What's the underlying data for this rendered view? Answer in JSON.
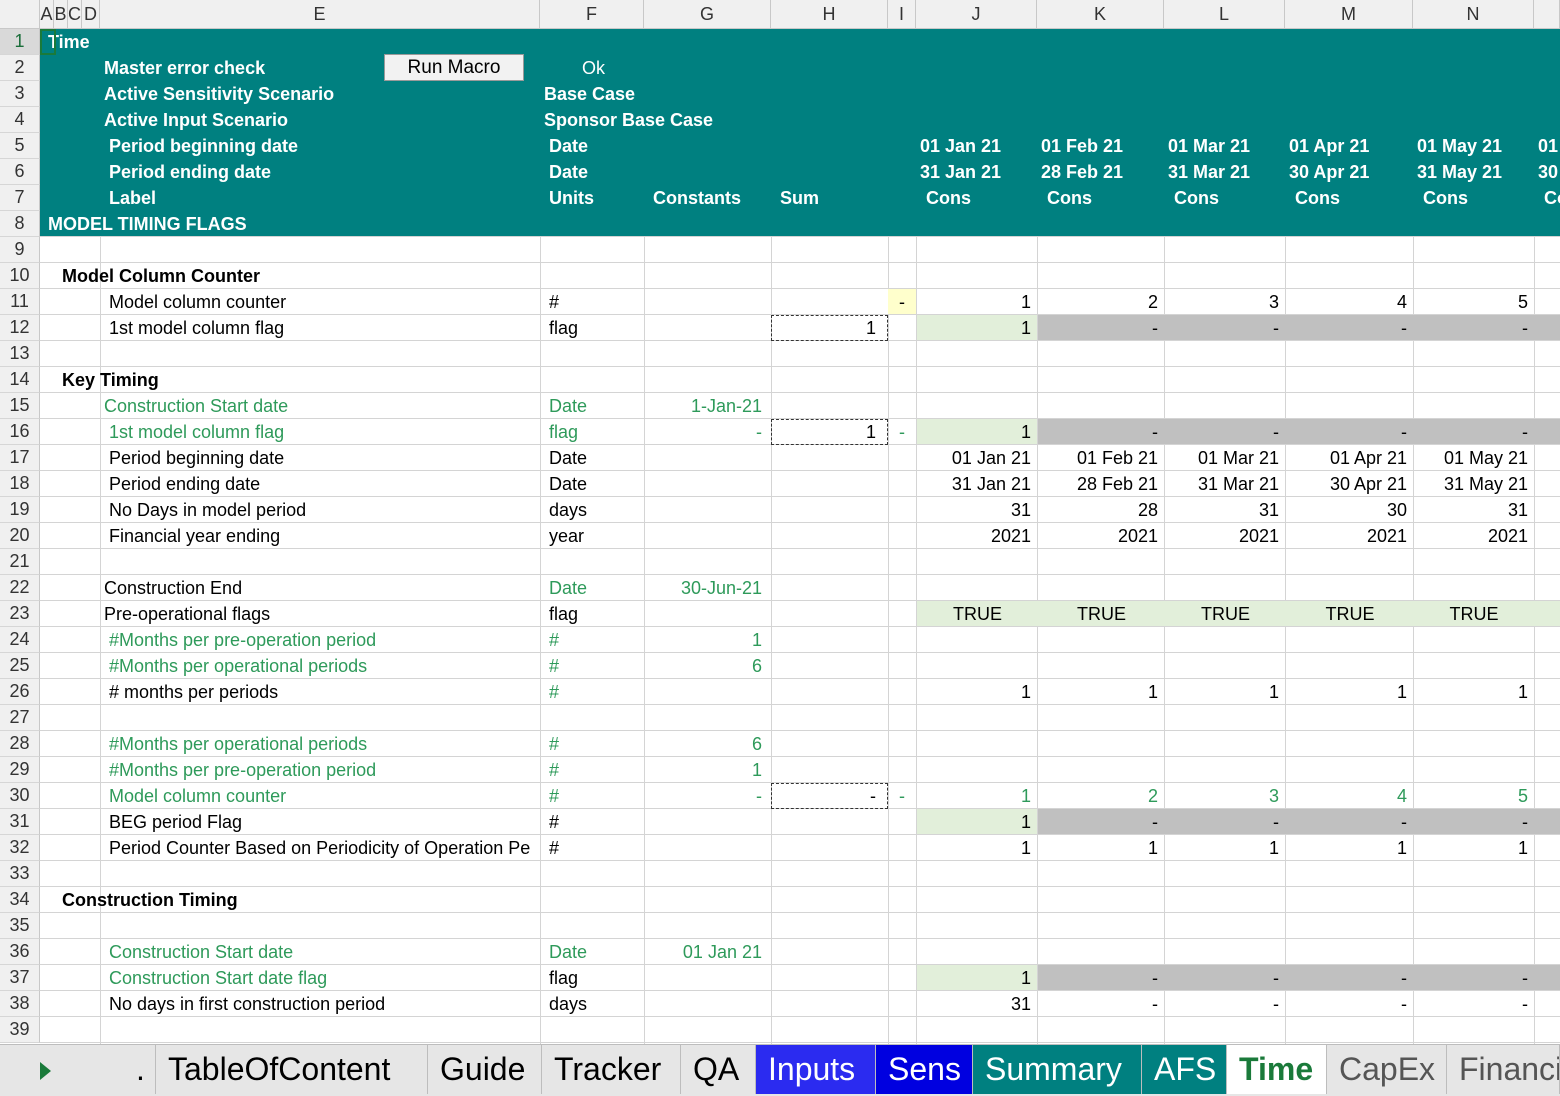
{
  "columns": [
    "A",
    "B",
    "C",
    "D",
    "E",
    "F",
    "G",
    "H",
    "I",
    "J",
    "K",
    "L",
    "M",
    "N"
  ],
  "rows": [
    "1",
    "2",
    "3",
    "4",
    "5",
    "6",
    "7",
    "8",
    "9",
    "10",
    "11",
    "12",
    "13",
    "14",
    "15",
    "16",
    "17",
    "18",
    "19",
    "20",
    "21",
    "22",
    "23",
    "24",
    "25",
    "26",
    "27",
    "28",
    "29",
    "30",
    "31",
    "32",
    "33",
    "34",
    "35",
    "36",
    "37",
    "38",
    "39"
  ],
  "header": {
    "sheet_title": "Time",
    "master_error_label": "Master error check",
    "run_macro_button": "Run Macro",
    "master_error_value": "Ok",
    "sens_label": "Active Sensitivity Scenario",
    "sens_value": "Base Case",
    "input_label": "Active Input Scenario",
    "input_value": "Sponsor Base Case",
    "pbd_label": "Period beginning date",
    "pbd_unit": "Date",
    "ped_label": "Period ending date",
    "ped_unit": "Date",
    "label_label": "Label",
    "units_header": "Units",
    "constants_header": "Constants",
    "sum_header": "Sum",
    "section_title": "MODEL TIMING FLAGS",
    "period_begin": [
      "01 Jan 21",
      "01 Feb 21",
      "01 Mar 21",
      "01 Apr 21",
      "01 May 21",
      "01"
    ],
    "period_end": [
      "31 Jan 21",
      "28 Feb 21",
      "31 Mar 21",
      "30 Apr 21",
      "31 May 21",
      "30"
    ],
    "period_label": [
      "Cons",
      "Cons",
      "Cons",
      "Cons",
      "Cons",
      "Co"
    ]
  },
  "body": {
    "r10": "Model Column Counter",
    "r11": {
      "label": "Model column counter",
      "unit": "#",
      "i": "-",
      "vals": [
        "1",
        "2",
        "3",
        "4",
        "5"
      ]
    },
    "r12": {
      "label": "1st model column flag",
      "unit": "flag",
      "sum": "1",
      "vals": [
        "1",
        "-",
        "-",
        "-",
        "-"
      ]
    },
    "r14": "Key Timing",
    "r15": {
      "label": "Construction Start date",
      "unit": "Date",
      "const": "1-Jan-21"
    },
    "r16": {
      "label": "1st model column flag",
      "unit": "flag",
      "const": "-",
      "sum": "1",
      "i": "-",
      "vals": [
        "1",
        "-",
        "-",
        "-",
        "-"
      ]
    },
    "r17": {
      "label": "Period beginning date",
      "unit": "Date",
      "vals": [
        "01 Jan 21",
        "01 Feb 21",
        "01 Mar 21",
        "01 Apr 21",
        "01 May 21"
      ]
    },
    "r18": {
      "label": "Period ending date",
      "unit": "Date",
      "vals": [
        "31 Jan 21",
        "28 Feb 21",
        "31 Mar 21",
        "30 Apr 21",
        "31 May 21"
      ]
    },
    "r19": {
      "label": "No Days in model period",
      "unit": "days",
      "vals": [
        "31",
        "28",
        "31",
        "30",
        "31"
      ]
    },
    "r20": {
      "label": "Financial year ending",
      "unit": "year",
      "vals": [
        "2021",
        "2021",
        "2021",
        "2021",
        "2021"
      ]
    },
    "r22": {
      "label": "Construction End",
      "unit": "Date",
      "const": "30-Jun-21"
    },
    "r23": {
      "label": "Pre-operational flags",
      "unit": "flag",
      "vals": [
        "TRUE",
        "TRUE",
        "TRUE",
        "TRUE",
        "TRUE"
      ]
    },
    "r24": {
      "label": "#Months per pre-operation period",
      "unit": "#",
      "const": "1"
    },
    "r25": {
      "label": "#Months per operational periods",
      "unit": "#",
      "const": "6"
    },
    "r26": {
      "label": "# months per periods",
      "unit": "#",
      "vals": [
        "1",
        "1",
        "1",
        "1",
        "1"
      ]
    },
    "r28": {
      "label": "#Months per operational periods",
      "unit": "#",
      "const": "6"
    },
    "r29": {
      "label": "#Months per pre-operation period",
      "unit": "#",
      "const": "1"
    },
    "r30": {
      "label": "Model column counter",
      "unit": "#",
      "const": "-",
      "sum": "-",
      "i": "-",
      "vals": [
        "1",
        "2",
        "3",
        "4",
        "5"
      ]
    },
    "r31": {
      "label": "BEG period Flag",
      "unit": "#",
      "vals": [
        "1",
        "-",
        "-",
        "-",
        "-"
      ]
    },
    "r32": {
      "label": "Period Counter Based on Periodicity of Operation Pe",
      "unit": "#",
      "vals": [
        "1",
        "1",
        "1",
        "1",
        "1"
      ]
    },
    "r34": "Construction Timing",
    "r36": {
      "label": "Construction Start date",
      "unit": "Date",
      "const": "01 Jan 21"
    },
    "r37": {
      "label": "Construction Start date flag",
      "unit": "flag",
      "vals": [
        "1",
        "-",
        "-",
        "-",
        "-"
      ]
    },
    "r38": {
      "label": "No days in first construction period",
      "unit": "days",
      "vals": [
        "31",
        "-",
        "-",
        "-",
        "-"
      ]
    }
  },
  "tabs": [
    {
      "label": ".",
      "bg": "#e6e6e6",
      "color": "#000000"
    },
    {
      "label": "TableOfContent",
      "bg": "#e6e6e6",
      "color": "#000000"
    },
    {
      "label": "Guide",
      "bg": "#e6e6e6",
      "color": "#000000"
    },
    {
      "label": "Tracker",
      "bg": "#e6e6e6",
      "color": "#000000"
    },
    {
      "label": "QA",
      "bg": "#e6e6e6",
      "color": "#000000"
    },
    {
      "label": "Inputs",
      "bg": "#2b2bf0",
      "color": "#ffffff"
    },
    {
      "label": "Sens",
      "bg": "#0000e0",
      "color": "#ffffff"
    },
    {
      "label": "Summary",
      "bg": "#008080",
      "color": "#ffffff"
    },
    {
      "label": "AFS",
      "bg": "#008080",
      "color": "#ffffff"
    },
    {
      "label": "Time",
      "bg": "#ffffff",
      "color": "#1a7a3a"
    },
    {
      "label": "CapEx",
      "bg": "#e6e6e6",
      "color": "#555555"
    },
    {
      "label": "Financi",
      "bg": "#e6e6e6",
      "color": "#555555"
    }
  ],
  "colors": {
    "header_band": "#008080",
    "input_green": "#2e9a5a",
    "flag_fill": "#e2efda",
    "grey_fill": "#c0c0c0"
  }
}
